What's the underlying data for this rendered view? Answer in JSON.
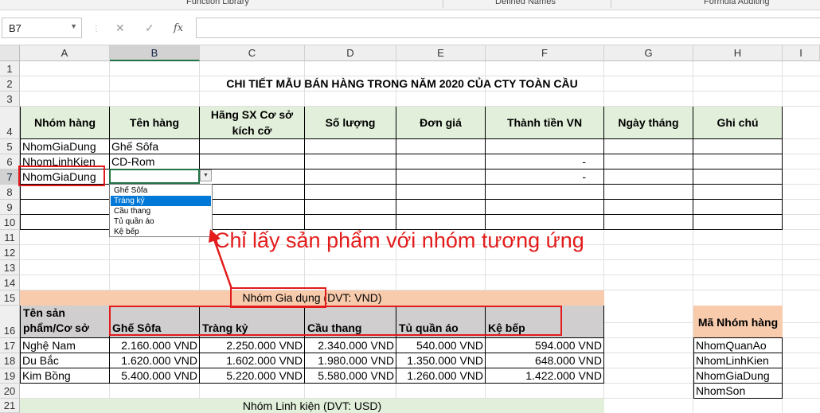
{
  "ribbon": {
    "groups": [
      "Function Library",
      "Defined Names",
      "Formula Auditing"
    ]
  },
  "formula_bar": {
    "name_box": "B7",
    "cancel_icon": "✕",
    "enter_icon": "✓",
    "fx_label": "fx",
    "formula": ""
  },
  "columns": [
    "A",
    "B",
    "C",
    "D",
    "E",
    "F",
    "G",
    "H",
    "I"
  ],
  "rows": [
    "1",
    "2",
    "3",
    "4",
    "5",
    "6",
    "7",
    "8",
    "9",
    "10",
    "11",
    "12",
    "13",
    "14",
    "15",
    "16",
    "17",
    "18",
    "19",
    "20",
    "21"
  ],
  "table1": {
    "title": "CHI TIẾT MẪU BÁN HÀNG TRONG NĂM 2020 CỦA CTY TOÀN CẦU",
    "headers": [
      "Nhóm hàng",
      "Tên hàng",
      "Hãng SX Cơ sở kích cỡ",
      "Số lượng",
      "Đơn giá",
      "Thành tiền VN",
      "Ngày tháng",
      "Ghi chú"
    ],
    "rows": [
      {
        "nhom": "NhomGiaDung",
        "ten": "Ghế Sôfa",
        "thanh_tien": ""
      },
      {
        "nhom": "NhomLinhKien",
        "ten": "CD-Rom",
        "thanh_tien": "-"
      },
      {
        "nhom": "NhomGiaDung",
        "ten": "",
        "thanh_tien": "-"
      }
    ]
  },
  "dropdown": {
    "items": [
      "Ghế Sôfa",
      "Tràng kỷ",
      "Cầu thang",
      "Tủ quần áo",
      "Kệ bếp"
    ],
    "highlighted_index": 1
  },
  "annotation": "Chỉ lấy sản phẩm với nhóm tương ứng",
  "table2": {
    "band_title": "Nhóm Gia dụng (DVT: VND)",
    "row_header": "Tên sản phẩm/Cơ sở",
    "products": [
      "Ghế Sôfa",
      "Tràng kỷ",
      "Cầu thang",
      "Tủ quần áo",
      "Kệ bếp"
    ],
    "rows": [
      {
        "name": "Nghệ Nam",
        "values": [
          "2.160.000 VND",
          "2.250.000 VND",
          "2.340.000 VND",
          "540.000 VND",
          "594.000 VND"
        ]
      },
      {
        "name": "Du Bắc",
        "values": [
          "1.620.000 VND",
          "1.602.000 VND",
          "1.980.000 VND",
          "1.350.000 VND",
          "648.000 VND"
        ]
      },
      {
        "name": "Kim Bồng",
        "values": [
          "5.400.000 VND",
          "5.220.000 VND",
          "5.580.000 VND",
          "1.260.000 VND",
          "1.422.000 VND"
        ]
      }
    ],
    "band2_title": "Nhóm Linh kiện (DVT: USD)"
  },
  "ma_nhom": {
    "header": "Mã Nhóm hàng",
    "items": [
      "NhomQuanAo",
      "NhomLinhKien",
      "NhomGiaDung",
      "NhomSon"
    ]
  },
  "colors": {
    "green_header": "#e2efda",
    "orange_band": "#f8cbad",
    "gray_header": "#d0cece",
    "annotation_red": "#e31b1b",
    "selection_green": "#217346",
    "dropdown_highlight": "#0078d7"
  }
}
